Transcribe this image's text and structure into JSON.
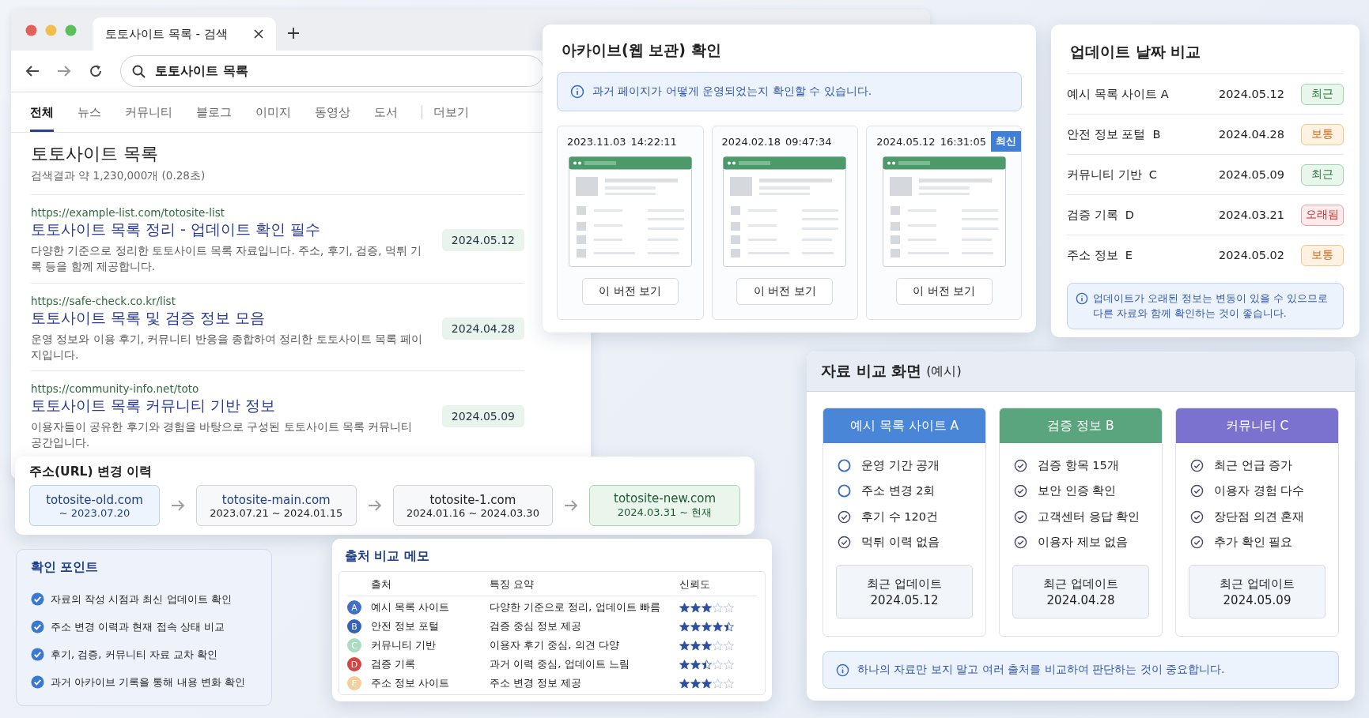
{
  "browser": {
    "tab_title": "토토사이트 목록 - 검색",
    "address": "토토사이트 목록",
    "tabs": [
      {
        "label": "전체",
        "selected": true
      },
      {
        "label": "뉴스",
        "selected": false
      },
      {
        "label": "커뮤니티",
        "selected": false
      },
      {
        "label": "블로그",
        "selected": false
      },
      {
        "label": "이미지",
        "selected": false
      },
      {
        "label": "동영상",
        "selected": false
      },
      {
        "label": "도서",
        "selected": false
      },
      {
        "label": "더보기",
        "selected": false
      }
    ],
    "heading": "토토사이트 목록",
    "result_count": "검색결과 약 1,230,000개 (0.28초)",
    "results": [
      {
        "url": "https://example-list.com/totosite-list",
        "title": "토토사이트 목록 정리 - 업데이트 확인 필수",
        "snippet": "다양한 기준으로 정리한 토토사이트 목록 자료입니다. 주소, 후기, 검증, 먹튀 기록 등을 함께 제공합니다.",
        "date": "2024.05.12"
      },
      {
        "url": "https://safe-check.co.kr/list",
        "title": "토토사이트 목록 및 검증 정보 모음",
        "snippet": "운영 정보와 이용 후기, 커뮤니티 반응을 종합하여 정리한 토토사이트 목록 페이지입니다.",
        "date": "2024.04.28"
      },
      {
        "url": "https://community-info.net/toto",
        "title": "토토사이트 목록 커뮤니티 기반 정보",
        "snippet": "이용자들이 공유한 후기와 경험을 바탕으로 구성된 토토사이트 목록 커뮤니티 공간입니다.",
        "date": "2024.05.09"
      }
    ]
  },
  "archive": {
    "title": "아카이브(웹 보관) 확인",
    "notice": "과거 페이지가 어떻게 운영되었는지 확인할 수 있습니다.",
    "snapshots": [
      {
        "date": "2023.11.03",
        "time": "14:22:11",
        "button": "이 버전 보기"
      },
      {
        "date": "2024.02.18",
        "time": "09:47:34",
        "button": "이 버전 보기"
      },
      {
        "date": "2024.05.12",
        "time": "16:31:05",
        "button": "이 버전 보기",
        "badge": "최신"
      }
    ]
  },
  "update_dates": {
    "title": "업데이트 날짜 비교",
    "rows": [
      {
        "name": "예시 목록 사이트 A",
        "date": "2024.05.12",
        "status": "최근",
        "kind": "recent"
      },
      {
        "name": "안전 정보 포털  B",
        "date": "2024.04.28",
        "status": "보통",
        "kind": "normal"
      },
      {
        "name": "커뮤니티 기반  C",
        "date": "2024.05.09",
        "status": "최근",
        "kind": "recent"
      },
      {
        "name": "검증 기록  D",
        "date": "2024.03.21",
        "status": "오래됨",
        "kind": "old"
      },
      {
        "name": "주소 정보  E",
        "date": "2024.05.02",
        "status": "보통",
        "kind": "normal"
      }
    ],
    "notice": "업데이트가 오래된 정보는 변동이 있을 수 있으므로 다른 자료와 함께 확인하는 것이 좋습니다."
  },
  "url_history": {
    "title": "주소(URL) 변경 이력",
    "entries": [
      {
        "domain": "totosite-old.com",
        "period": "~ 2023.07.20",
        "kind": "old"
      },
      {
        "domain": "totosite-main.com",
        "period": "2023.07.21 ~ 2024.01.15",
        "kind": "past"
      },
      {
        "domain": "totosite-1.com",
        "period": "2024.01.16 ~ 2024.03.30",
        "kind": "past"
      },
      {
        "domain": "totosite-new.com",
        "period": "2024.03.31 ~ 현재",
        "kind": "current"
      }
    ]
  },
  "check_points": {
    "title": "확인 포인트",
    "items": [
      "자료의 작성 시점과 최신 업데이트 확인",
      "주소 변경 이력과 현재 접속 상태 비교",
      "후기, 검증, 커뮤니티 자료 교차 확인",
      "과거 아카이브 기록을 통해 내용 변화 확인"
    ]
  },
  "source_memo": {
    "title": "출처 비교 메모",
    "columns": [
      "출처",
      "특징 요약",
      "신뢰도"
    ],
    "rows": [
      {
        "letter": "A",
        "color": "#3f6fc9",
        "source": "예시 목록 사이트",
        "summary": "다양한 기준으로 정리, 업데이트 빠름",
        "stars": 3
      },
      {
        "letter": "B",
        "color": "#3563b8",
        "source": "안전 정보 포털",
        "summary": "검증 중심 정보 제공",
        "stars": 4.5
      },
      {
        "letter": "C",
        "color": "#a9dcc0",
        "source": "커뮤니티 기반",
        "summary": "이용자 후기 중심, 의견 다양",
        "stars": 3
      },
      {
        "letter": "D",
        "color": "#d64545",
        "source": "검증 기록",
        "summary": "과거 이력 중심, 업데이트 느림",
        "stars": 2.5
      },
      {
        "letter": "E",
        "color": "#f5cf9b",
        "source": "주소 정보 사이트",
        "summary": "주소 변경 정보 제공",
        "stars": 3
      }
    ]
  },
  "comparison": {
    "title": "자료 비교 화면",
    "title_note": "(예시)",
    "columns": [
      {
        "name": "예시 목록 사이트 A",
        "color": "#4a86d8",
        "items": [
          {
            "label": "운영 기간 공개",
            "checked": false
          },
          {
            "label": "주소 변경 2회",
            "checked": false
          },
          {
            "label": "후기 수 120건",
            "checked": true
          },
          {
            "label": "먹튀 이력 없음",
            "checked": true
          }
        ],
        "update_label": "최근 업데이트",
        "update_date": "2024.05.12"
      },
      {
        "name": "검증 정보 B",
        "color": "#5aa57e",
        "items": [
          {
            "label": "검증 항목 15개",
            "checked": true
          },
          {
            "label": "보안 인증 확인",
            "checked": true
          },
          {
            "label": "고객센터 응답 확인",
            "checked": true
          },
          {
            "label": "이용자 제보 없음",
            "checked": true
          }
        ],
        "update_label": "최근 업데이트",
        "update_date": "2024.04.28"
      },
      {
        "name": "커뮤니티 C",
        "color": "#7b72cf",
        "items": [
          {
            "label": "최근 언급 증가",
            "checked": true
          },
          {
            "label": "이용자 경험 다수",
            "checked": true
          },
          {
            "label": "장단점 의견 혼재",
            "checked": true
          },
          {
            "label": "추가 확인 필요",
            "checked": true
          }
        ],
        "update_label": "최근 업데이트",
        "update_date": "2024.05.09"
      }
    ],
    "notice": "하나의 자료만 보지 말고 여러 출처를 비교하여 판단하는 것이 중요합니다."
  }
}
